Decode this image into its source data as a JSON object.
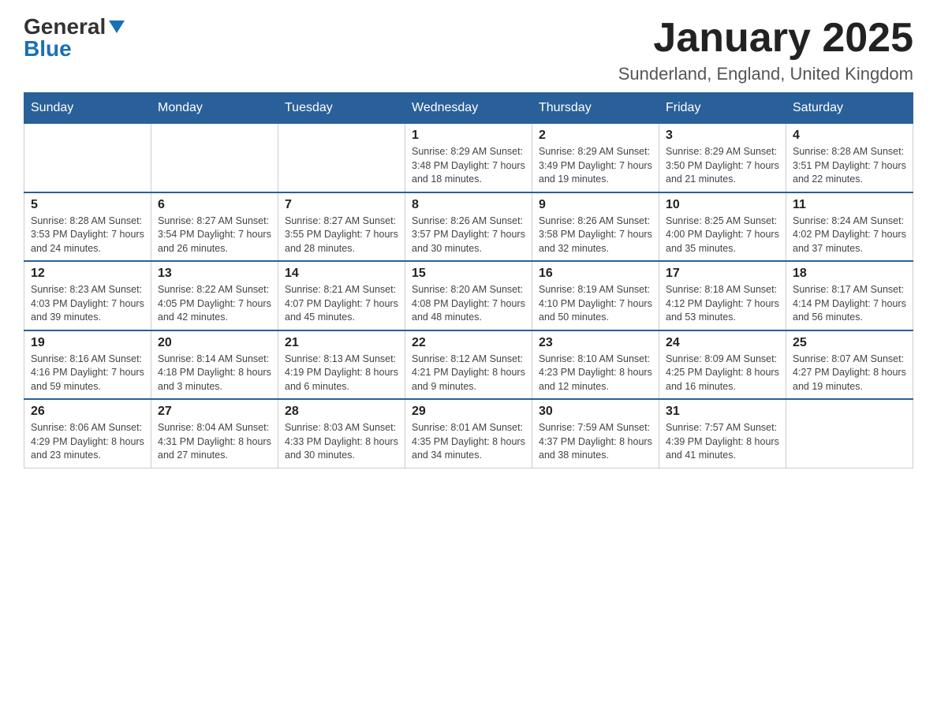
{
  "header": {
    "logo_general": "General",
    "logo_blue": "Blue",
    "month_title": "January 2025",
    "location": "Sunderland, England, United Kingdom"
  },
  "days_of_week": [
    "Sunday",
    "Monday",
    "Tuesday",
    "Wednesday",
    "Thursday",
    "Friday",
    "Saturday"
  ],
  "weeks": [
    [
      {
        "day": "",
        "info": ""
      },
      {
        "day": "",
        "info": ""
      },
      {
        "day": "",
        "info": ""
      },
      {
        "day": "1",
        "info": "Sunrise: 8:29 AM\nSunset: 3:48 PM\nDaylight: 7 hours\nand 18 minutes."
      },
      {
        "day": "2",
        "info": "Sunrise: 8:29 AM\nSunset: 3:49 PM\nDaylight: 7 hours\nand 19 minutes."
      },
      {
        "day": "3",
        "info": "Sunrise: 8:29 AM\nSunset: 3:50 PM\nDaylight: 7 hours\nand 21 minutes."
      },
      {
        "day": "4",
        "info": "Sunrise: 8:28 AM\nSunset: 3:51 PM\nDaylight: 7 hours\nand 22 minutes."
      }
    ],
    [
      {
        "day": "5",
        "info": "Sunrise: 8:28 AM\nSunset: 3:53 PM\nDaylight: 7 hours\nand 24 minutes."
      },
      {
        "day": "6",
        "info": "Sunrise: 8:27 AM\nSunset: 3:54 PM\nDaylight: 7 hours\nand 26 minutes."
      },
      {
        "day": "7",
        "info": "Sunrise: 8:27 AM\nSunset: 3:55 PM\nDaylight: 7 hours\nand 28 minutes."
      },
      {
        "day": "8",
        "info": "Sunrise: 8:26 AM\nSunset: 3:57 PM\nDaylight: 7 hours\nand 30 minutes."
      },
      {
        "day": "9",
        "info": "Sunrise: 8:26 AM\nSunset: 3:58 PM\nDaylight: 7 hours\nand 32 minutes."
      },
      {
        "day": "10",
        "info": "Sunrise: 8:25 AM\nSunset: 4:00 PM\nDaylight: 7 hours\nand 35 minutes."
      },
      {
        "day": "11",
        "info": "Sunrise: 8:24 AM\nSunset: 4:02 PM\nDaylight: 7 hours\nand 37 minutes."
      }
    ],
    [
      {
        "day": "12",
        "info": "Sunrise: 8:23 AM\nSunset: 4:03 PM\nDaylight: 7 hours\nand 39 minutes."
      },
      {
        "day": "13",
        "info": "Sunrise: 8:22 AM\nSunset: 4:05 PM\nDaylight: 7 hours\nand 42 minutes."
      },
      {
        "day": "14",
        "info": "Sunrise: 8:21 AM\nSunset: 4:07 PM\nDaylight: 7 hours\nand 45 minutes."
      },
      {
        "day": "15",
        "info": "Sunrise: 8:20 AM\nSunset: 4:08 PM\nDaylight: 7 hours\nand 48 minutes."
      },
      {
        "day": "16",
        "info": "Sunrise: 8:19 AM\nSunset: 4:10 PM\nDaylight: 7 hours\nand 50 minutes."
      },
      {
        "day": "17",
        "info": "Sunrise: 8:18 AM\nSunset: 4:12 PM\nDaylight: 7 hours\nand 53 minutes."
      },
      {
        "day": "18",
        "info": "Sunrise: 8:17 AM\nSunset: 4:14 PM\nDaylight: 7 hours\nand 56 minutes."
      }
    ],
    [
      {
        "day": "19",
        "info": "Sunrise: 8:16 AM\nSunset: 4:16 PM\nDaylight: 7 hours\nand 59 minutes."
      },
      {
        "day": "20",
        "info": "Sunrise: 8:14 AM\nSunset: 4:18 PM\nDaylight: 8 hours\nand 3 minutes."
      },
      {
        "day": "21",
        "info": "Sunrise: 8:13 AM\nSunset: 4:19 PM\nDaylight: 8 hours\nand 6 minutes."
      },
      {
        "day": "22",
        "info": "Sunrise: 8:12 AM\nSunset: 4:21 PM\nDaylight: 8 hours\nand 9 minutes."
      },
      {
        "day": "23",
        "info": "Sunrise: 8:10 AM\nSunset: 4:23 PM\nDaylight: 8 hours\nand 12 minutes."
      },
      {
        "day": "24",
        "info": "Sunrise: 8:09 AM\nSunset: 4:25 PM\nDaylight: 8 hours\nand 16 minutes."
      },
      {
        "day": "25",
        "info": "Sunrise: 8:07 AM\nSunset: 4:27 PM\nDaylight: 8 hours\nand 19 minutes."
      }
    ],
    [
      {
        "day": "26",
        "info": "Sunrise: 8:06 AM\nSunset: 4:29 PM\nDaylight: 8 hours\nand 23 minutes."
      },
      {
        "day": "27",
        "info": "Sunrise: 8:04 AM\nSunset: 4:31 PM\nDaylight: 8 hours\nand 27 minutes."
      },
      {
        "day": "28",
        "info": "Sunrise: 8:03 AM\nSunset: 4:33 PM\nDaylight: 8 hours\nand 30 minutes."
      },
      {
        "day": "29",
        "info": "Sunrise: 8:01 AM\nSunset: 4:35 PM\nDaylight: 8 hours\nand 34 minutes."
      },
      {
        "day": "30",
        "info": "Sunrise: 7:59 AM\nSunset: 4:37 PM\nDaylight: 8 hours\nand 38 minutes."
      },
      {
        "day": "31",
        "info": "Sunrise: 7:57 AM\nSunset: 4:39 PM\nDaylight: 8 hours\nand 41 minutes."
      },
      {
        "day": "",
        "info": ""
      }
    ]
  ]
}
